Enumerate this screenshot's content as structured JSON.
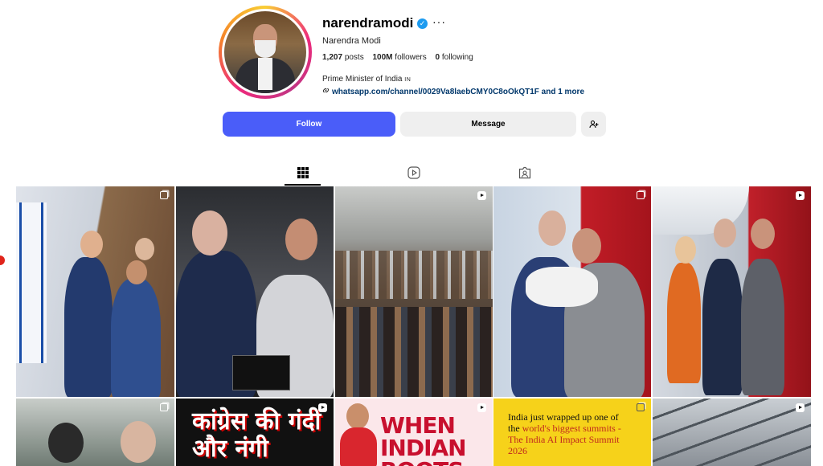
{
  "profile": {
    "username": "narendramodi",
    "full_name": "Narendra Modi",
    "verified_icon": "✓",
    "more_icon": "···",
    "posts_count": "1,207",
    "posts_label": "posts",
    "followers_count": "100M",
    "followers_label": "followers",
    "following_count": "0",
    "following_label": "following",
    "bio": "Prime Minister of India",
    "bio_tag": "IN",
    "link": "whatsapp.com/channel/0029Va8laebCMY0C8oOkQT1F and 1 more"
  },
  "actions": {
    "follow_label": "Follow",
    "message_label": "Message",
    "add_person_icon": "+"
  },
  "colors": {
    "follow_button": "#4a5df9",
    "link_text": "#00376b",
    "verified_badge": "#1d9bf0"
  },
  "tabs": [
    {
      "name": "posts",
      "icon": "grid-icon",
      "active": true
    },
    {
      "name": "reels",
      "icon": "reels-icon",
      "active": false
    },
    {
      "name": "tagged",
      "icon": "tagged-icon",
      "active": false
    }
  ],
  "grid": {
    "tile7_text": "कांग्रेस की गंदी और नंगी",
    "tile8_text": "WHEN INDIAN ROOTS",
    "tile9_text_a": "India just wrapped up one of the ",
    "tile9_text_hl": "world's biggest summits - The India AI Impact Summit 2026"
  }
}
